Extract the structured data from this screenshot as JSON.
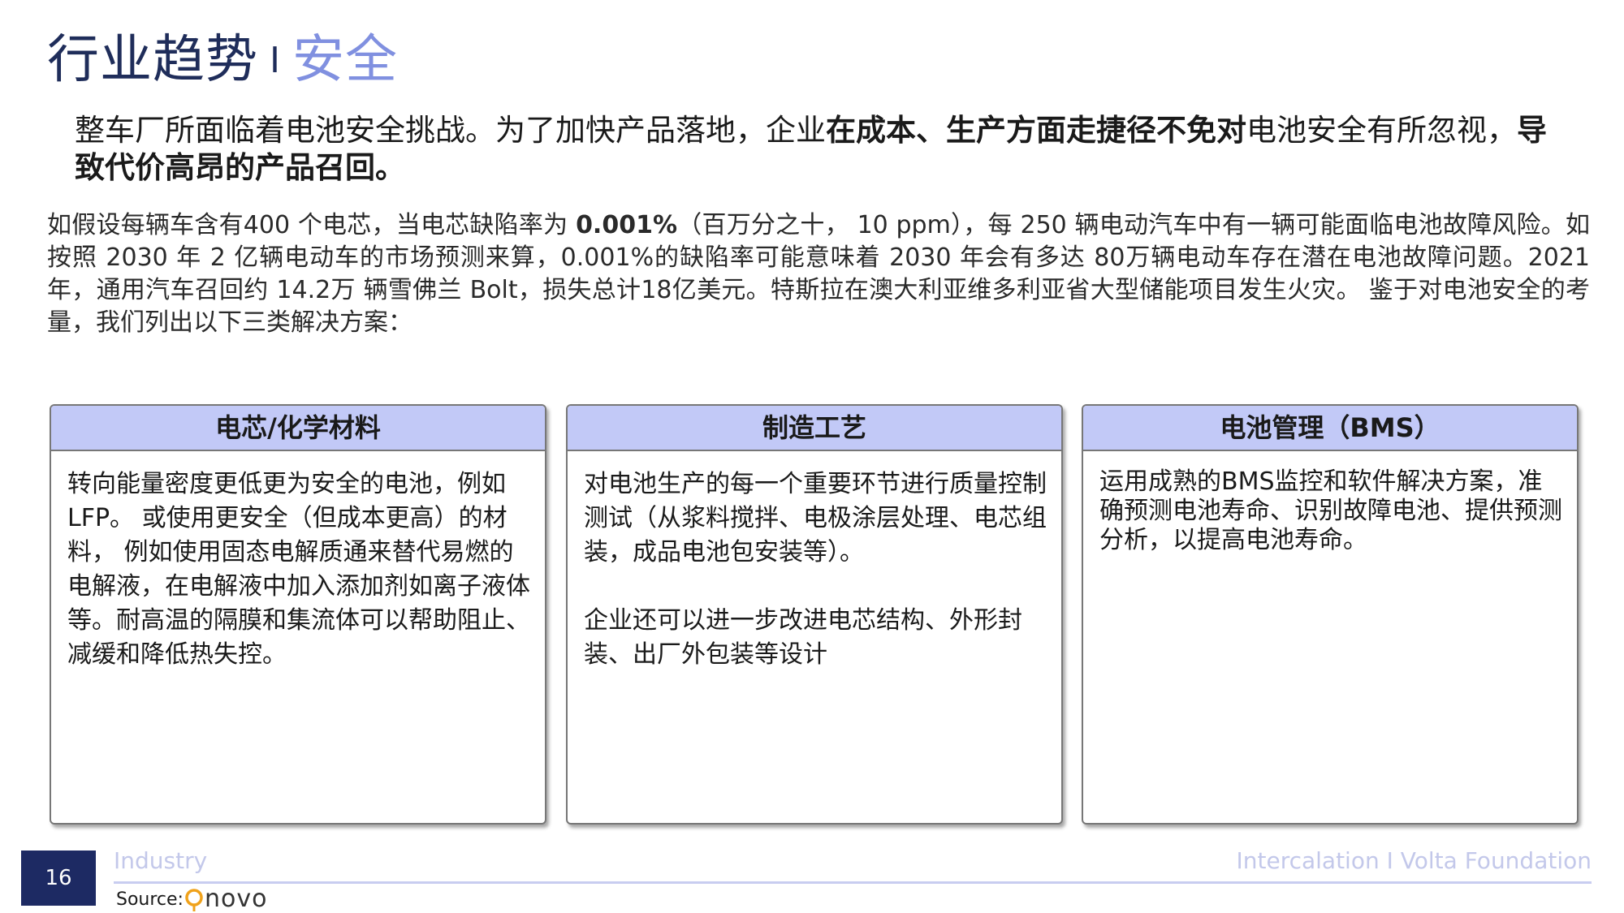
{
  "title": {
    "main": "行业趋势",
    "separator": "I",
    "sub": "安全"
  },
  "lead": {
    "part1": "整车厂所面临着电池安全挑战。为了加快产品落地，企业",
    "bold1": "在成本、生产方面走捷径不免对",
    "part2": "电池安全有所忽视，",
    "bold2": "导致代价高昂的产品召回。"
  },
  "intro": {
    "part1": "如假设每辆车含有400 个电芯，当电芯缺陷率为 ",
    "bold": "0.001%",
    "part2": "（百万分之十， 10 ppm），每 250 辆电动汽车中有一辆可能面临电池故障风险。如按照 2030 年 2 亿辆电动车的市场预测来算，0.001%的缺陷率可能意味着 2030 年会有多达 80万辆电动车存在潜在电池故障问题。2021 年，通用汽车召回约 14.2万 辆雪佛兰 Bolt，损失总计18亿美元。特斯拉在澳大利亚维多利亚省大型储能项目发生火灾。 鉴于对电池安全的考量，我们列出以下三类解决方案："
  },
  "cards": [
    {
      "header": "电芯/化学材料",
      "body": "转向能量密度更低更为安全的电池，例如LFP。 或使用更安全（但成本更高）的材料， 例如使用固态电解质通来替代易燃的电解液，在电解液中加入添加剂如离子液体等。耐高温的隔膜和集流体可以帮助阻止、减缓和降低热失控。"
    },
    {
      "header": "制造工艺",
      "body": "对电池生产的每一个重要环节进行质量控制测试（从浆料搅拌、电极涂层处理、电芯组装，成品电池包安装等）。\n\n企业还可以进一步改进电芯结构、外形封装、出厂外包装等设计"
    },
    {
      "header": "电池管理（BMS）",
      "body": "运用成熟的BMS监控和软件解决方案，准确预测电池寿命、识别故障电池、提供预测分析，以提高电池寿命。"
    }
  ],
  "footer": {
    "page_number": "16",
    "section": "Industry",
    "brand": "Intercalation I Volta Foundation",
    "source_label": "Source:",
    "logo_text": "novo"
  },
  "colors": {
    "title": "#1f2d5a",
    "subtitle": "#8090e0",
    "card_header_bg": "#c2c9f7",
    "footer_badge": "#1d2a63",
    "footer_text": "#c3c8ea"
  }
}
